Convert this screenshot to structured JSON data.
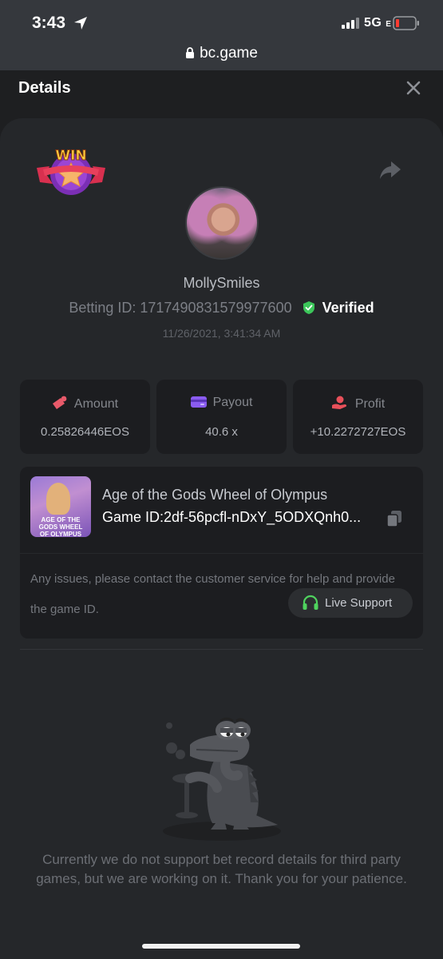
{
  "status_bar": {
    "time": "3:43",
    "network": "5G",
    "network_suffix": "E",
    "url": "bc.game"
  },
  "header": {
    "title": "Details"
  },
  "bet": {
    "badge": "WIN",
    "username": "MollySmiles",
    "betting_id_label": "Betting ID: 1717490831579977600",
    "verified_label": "Verified",
    "timestamp": "11/26/2021, 3:41:34 AM"
  },
  "stats": [
    {
      "label": "Amount",
      "value": "0.25826446EOS"
    },
    {
      "label": "Payout",
      "value": "40.6 x"
    },
    {
      "label": "Profit",
      "value": "+10.2272727EOS"
    }
  ],
  "game": {
    "thumb_text": "AGE OF THE GODS WHEEL OF OLYMPUS",
    "name": "Age of the Gods Wheel of Olympus",
    "id_label": "Game ID:2df-56pcfl-nDxY_5ODXQnh0...",
    "note": "Any issues, please contact the customer service for help and provide the game ID.",
    "support_label": "Live Support"
  },
  "empty_state": {
    "message": "Currently we do not support bet record details for third party games, but we are working on it. Thank you for your patience."
  },
  "colors": {
    "background": "#1e1f21",
    "panel": "#25272a",
    "box": "#1c1d20",
    "verified_green": "#3cc65a",
    "amount_red": "#e85a6a",
    "payout_purple": "#8a5cf0",
    "support_green": "#4fd35e"
  }
}
